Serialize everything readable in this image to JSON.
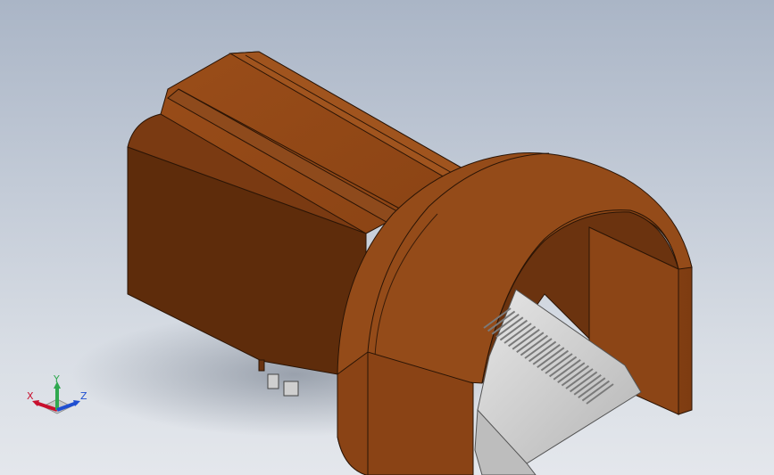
{
  "viewport": {
    "background_top": "#aab5c6",
    "background_bottom": "#e4e7ec"
  },
  "model": {
    "body_color": "#8f4717",
    "shadow_color": "#5a2a0c",
    "pedal_color": "#d0d0d0"
  },
  "triad": {
    "x_label": "X",
    "y_label": "Y",
    "z_label": "Z",
    "x_color": "#c8102e",
    "y_color": "#2fa84f",
    "z_color": "#1f4fd1"
  }
}
